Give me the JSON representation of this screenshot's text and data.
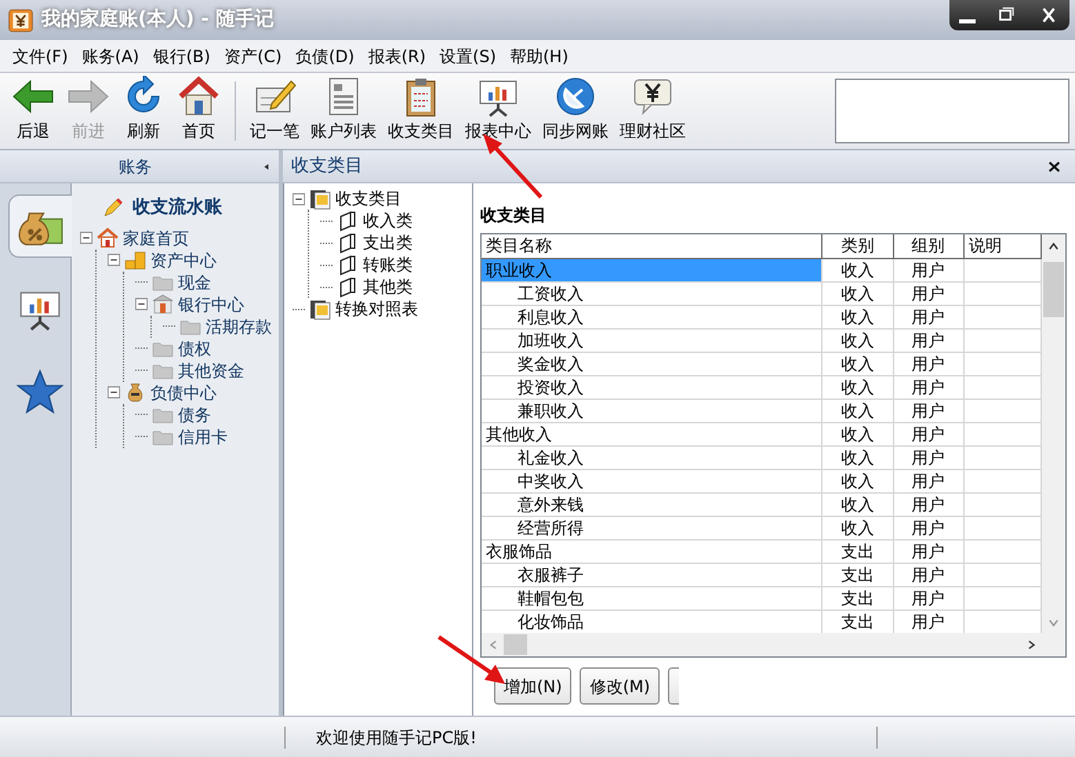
{
  "window": {
    "title": "我的家庭账(本人) - 随手记"
  },
  "menu": [
    "文件(F)",
    "账务(A)",
    "银行(B)",
    "资产(C)",
    "负债(D)",
    "报表(R)",
    "设置(S)",
    "帮助(H)"
  ],
  "toolbar": [
    {
      "label": "后退",
      "disabled": false
    },
    {
      "label": "前进",
      "disabled": true
    },
    {
      "label": "刷新",
      "disabled": false
    },
    {
      "label": "首页",
      "disabled": false
    },
    {
      "label": "记一笔",
      "disabled": false
    },
    {
      "label": "账户列表",
      "disabled": false
    },
    {
      "label": "收支类目",
      "disabled": false
    },
    {
      "label": "报表中心",
      "disabled": false
    },
    {
      "label": "同步网账",
      "disabled": false
    },
    {
      "label": "理财社区",
      "disabled": false
    }
  ],
  "sidebar": {
    "header": "账务",
    "tabs": [
      {
        "selected": true
      },
      {
        "selected": false
      },
      {
        "selected": false
      }
    ],
    "title": "收支流水账",
    "tree": [
      {
        "label": "家庭首页",
        "kind": "home",
        "expanded": true,
        "children": [
          {
            "label": "资产中心",
            "kind": "assets",
            "expanded": true,
            "children": [
              {
                "label": "现金",
                "kind": "account"
              },
              {
                "label": "银行中心",
                "kind": "bank",
                "expanded": true,
                "children": [
                  {
                    "label": "活期存款",
                    "kind": "account"
                  }
                ]
              },
              {
                "label": "债权",
                "kind": "account"
              },
              {
                "label": "其他资金",
                "kind": "account"
              }
            ]
          },
          {
            "label": "负债中心",
            "kind": "liabilities",
            "expanded": true,
            "children": [
              {
                "label": "债务",
                "kind": "account"
              },
              {
                "label": "信用卡",
                "kind": "account"
              }
            ]
          }
        ]
      }
    ]
  },
  "panel": {
    "title": "收支类目",
    "tree": [
      {
        "label": "收支类目",
        "kind": "table",
        "expanded": true,
        "children": [
          {
            "label": "收入类",
            "kind": "page"
          },
          {
            "label": "支出类",
            "kind": "page"
          },
          {
            "label": "转账类",
            "kind": "page"
          },
          {
            "label": "其他类",
            "kind": "page"
          }
        ]
      },
      {
        "label": "转换对照表",
        "kind": "table"
      }
    ],
    "heading": "收支类目",
    "table": {
      "columns": [
        "类目名称",
        "类别",
        "组别",
        "说明"
      ],
      "rows": [
        {
          "name": "职业收入",
          "type": "收入",
          "group": "用户",
          "selected": true,
          "children": [
            {
              "name": "工资收入",
              "type": "收入",
              "group": "用户",
              "selected": false
            },
            {
              "name": "利息收入",
              "type": "收入",
              "group": "用户",
              "selected": false
            },
            {
              "name": "加班收入",
              "type": "收入",
              "group": "用户",
              "selected": false
            },
            {
              "name": "奖金收入",
              "type": "收入",
              "group": "用户",
              "selected": false
            },
            {
              "name": "投资收入",
              "type": "收入",
              "group": "用户",
              "selected": false
            },
            {
              "name": "兼职收入",
              "type": "收入",
              "group": "用户",
              "selected": false
            }
          ]
        },
        {
          "name": "其他收入",
          "type": "收入",
          "group": "用户",
          "selected": false,
          "children": [
            {
              "name": "礼金收入",
              "type": "收入",
              "group": "用户",
              "selected": false
            },
            {
              "name": "中奖收入",
              "type": "收入",
              "group": "用户",
              "selected": false
            },
            {
              "name": "意外来钱",
              "type": "收入",
              "group": "用户",
              "selected": false
            },
            {
              "name": "经营所得",
              "type": "收入",
              "group": "用户",
              "selected": false
            }
          ]
        },
        {
          "name": "衣服饰品",
          "type": "支出",
          "group": "用户",
          "selected": false,
          "children": [
            {
              "name": "衣服裤子",
              "type": "支出",
              "group": "用户",
              "selected": false
            },
            {
              "name": "鞋帽包包",
              "type": "支出",
              "group": "用户",
              "selected": false
            },
            {
              "name": "化妆饰品",
              "type": "支出",
              "group": "用户",
              "selected": false
            }
          ]
        }
      ]
    },
    "buttons": [
      "增加(N)",
      "修改(M)"
    ]
  },
  "status_bar": "欢迎使用随手记PC版!"
}
